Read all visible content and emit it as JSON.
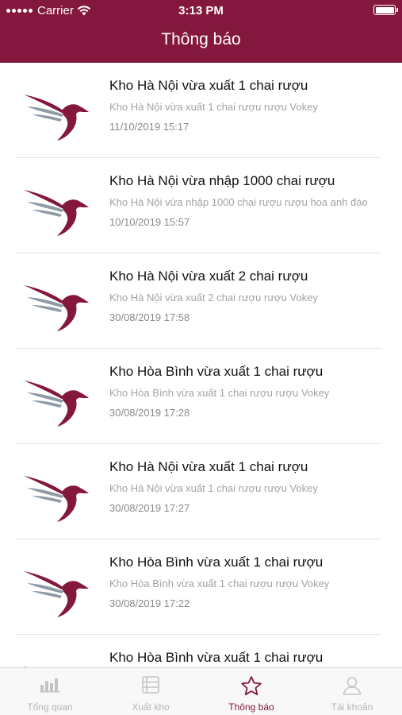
{
  "status_bar": {
    "carrier": "Carrier",
    "time": "3:13 PM"
  },
  "header": {
    "title": "Thông báo"
  },
  "notifications": [
    {
      "title": "Kho Hà Nội vừa xuất 1 chai rượu",
      "subtitle": "Kho Hà Nội vừa xuất 1 chai rượu rượu Vokey",
      "date": "11/10/2019 15:17"
    },
    {
      "title": "Kho Hà Nội vừa nhập 1000 chai rượu",
      "subtitle": "Kho Hà Nội vừa nhập 1000 chai rượu rượu hoa anh đào",
      "date": "10/10/2019 15:57"
    },
    {
      "title": "Kho Hà Nội vừa xuất 2 chai rượu",
      "subtitle": "Kho Hà Nội vừa xuất 2 chai rượu rượu Vokey",
      "date": "30/08/2019 17:58"
    },
    {
      "title": "Kho Hòa Bình vừa xuất 1 chai rượu",
      "subtitle": "Kho Hòa Bình vừa xuất 1 chai rượu rượu Vokey",
      "date": "30/08/2019 17:28"
    },
    {
      "title": "Kho Hà Nội vừa xuất 1 chai rượu",
      "subtitle": "Kho Hà Nội vừa xuất 1 chai rượu rượu Vokey",
      "date": "30/08/2019 17:27"
    },
    {
      "title": "Kho Hòa Bình vừa xuất 1 chai rượu",
      "subtitle": "Kho Hòa Bình vừa xuất 1 chai rượu rượu Vokey",
      "date": "30/08/2019 17:22"
    },
    {
      "title": "Kho Hòa Bình vừa xuất 1 chai rượu",
      "subtitle": "",
      "date": ""
    }
  ],
  "tabbar": {
    "items": [
      {
        "label": "Tổng quan",
        "icon": "bar-chart-icon"
      },
      {
        "label": "Xuất kho",
        "icon": "list-icon"
      },
      {
        "label": "Thông báo",
        "icon": "star-icon",
        "active": true
      },
      {
        "label": "Tài khoản",
        "icon": "user-icon"
      }
    ]
  },
  "colors": {
    "brand": "#84173d",
    "wing": "#8e9aa6",
    "inactive_tab": "#b5b5b5"
  }
}
